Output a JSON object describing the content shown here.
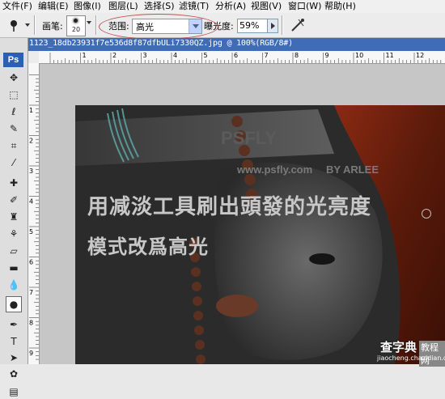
{
  "menu": [
    "文件(F)",
    "编辑(E)",
    "图像(I)",
    "图层(L)",
    "选择(S)",
    "滤镜(T)",
    "分析(A)",
    "视图(V)",
    "窗口(W)",
    "帮助(H)"
  ],
  "options": {
    "brush_label": "画笔:",
    "brush_size": "20",
    "range_label": "范围:",
    "range_value": "高光",
    "exposure_label": "曝光度:",
    "exposure_value": "59%"
  },
  "document": {
    "title": "1123_18db23931f7e536d8f87dfbULi7330QZ.jpg @ 100%(RGB/8#)"
  },
  "ruler": {
    "h_labels": [
      "1",
      "2",
      "3",
      "4",
      "5",
      "6",
      "7",
      "8",
      "9",
      "10",
      "11",
      "12"
    ],
    "v_labels": [
      "1",
      "2",
      "3",
      "4",
      "5",
      "6",
      "7",
      "8",
      "9"
    ]
  },
  "toolbox": {
    "logo": "Ps"
  },
  "image": {
    "caption_line1": "用减淡工具刷出頭發的光亮度",
    "caption_line2": "模式改爲高光",
    "watermark_url": "www.psfly.com",
    "watermark_brand": "PSFLY",
    "watermark_author": "BY ARLEE",
    "site_watermark": "查字典",
    "site_watermark_tag": "教程网",
    "site_url": "jiaocheng.chazidian.com"
  },
  "colors": {
    "title_bar": "#3f6bb7",
    "highlight_circle": "#c05050"
  }
}
